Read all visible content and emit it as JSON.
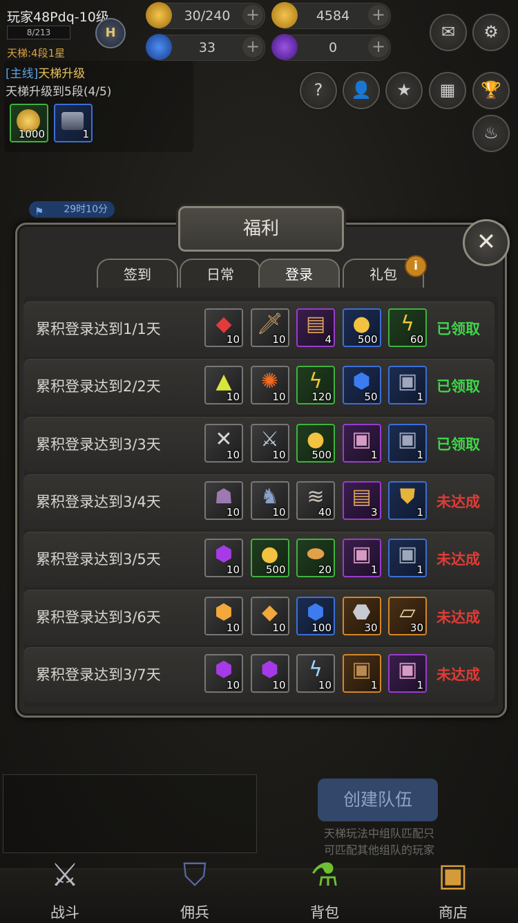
{
  "player": {
    "name": "玩家48Pdq-10级",
    "exp": "8/213",
    "ladder_rank": "天梯:4段1星",
    "badge": "H"
  },
  "resources": {
    "energy": "30/240",
    "gold": "4584",
    "gems": "33",
    "crystals": "0",
    "plus": "+"
  },
  "quest": {
    "tag": "[主线]",
    "title": "天梯升级",
    "desc": "天梯升级到5段(4/5)",
    "rewards": [
      {
        "icon": "gold-coin",
        "count": "1000"
      },
      {
        "icon": "iron-chest",
        "count": "1"
      }
    ]
  },
  "timer": "29时10分",
  "dialog": {
    "title": "福利",
    "close": "✕",
    "tabs": [
      "签到",
      "日常",
      "登录",
      "礼包"
    ],
    "active_tab": "登录",
    "info_badge": "i",
    "rows": [
      {
        "label": "累积登录达到1/1天",
        "status": "已领取",
        "items": [
          {
            "icon": "red-gem",
            "count": "10"
          },
          {
            "icon": "dagger",
            "count": "10"
          },
          {
            "icon": "scroll",
            "count": "4"
          },
          {
            "icon": "gold-coin",
            "count": "500"
          },
          {
            "icon": "energy",
            "count": "60"
          }
        ]
      },
      {
        "label": "累积登录达到2/2天",
        "status": "已领取",
        "items": [
          {
            "icon": "yellow-crystal",
            "count": "10"
          },
          {
            "icon": "fireball",
            "count": "10"
          },
          {
            "icon": "energy",
            "count": "120"
          },
          {
            "icon": "blue-gem",
            "count": "50"
          },
          {
            "icon": "iron-chest",
            "count": "1"
          }
        ]
      },
      {
        "label": "累积登录达到3/3天",
        "status": "已领取",
        "items": [
          {
            "icon": "blades",
            "count": "10"
          },
          {
            "icon": "crossed-swords",
            "count": "10"
          },
          {
            "icon": "gold-coin",
            "count": "500"
          },
          {
            "icon": "pink-chest",
            "count": "1"
          },
          {
            "icon": "iron-chest",
            "count": "1"
          }
        ]
      },
      {
        "label": "累积登录达到3/4天",
        "status": "未达成",
        "items": [
          {
            "icon": "hero-group",
            "count": "10"
          },
          {
            "icon": "knight",
            "count": "10"
          },
          {
            "icon": "cloth",
            "count": "40"
          },
          {
            "icon": "scroll",
            "count": "3"
          },
          {
            "icon": "rune-shield",
            "count": "1"
          }
        ]
      },
      {
        "label": "累积登录达到3/5天",
        "status": "未达成",
        "items": [
          {
            "icon": "purple-gem",
            "count": "10"
          },
          {
            "icon": "gold-coin",
            "count": "500"
          },
          {
            "icon": "ore",
            "count": "20"
          },
          {
            "icon": "pink-chest",
            "count": "1"
          },
          {
            "icon": "iron-chest",
            "count": "1"
          }
        ]
      },
      {
        "label": "累积登录达到3/6天",
        "status": "未达成",
        "items": [
          {
            "icon": "amber-gem",
            "count": "10"
          },
          {
            "icon": "amber-crystal",
            "count": "10"
          },
          {
            "icon": "blue-gem",
            "count": "100"
          },
          {
            "icon": "silver-gem",
            "count": "30"
          },
          {
            "icon": "book",
            "count": "30"
          }
        ]
      },
      {
        "label": "累积登录达到3/7天",
        "status": "未达成",
        "items": [
          {
            "icon": "purple-gem",
            "count": "10"
          },
          {
            "icon": "purple-gem",
            "count": "10"
          },
          {
            "icon": "lightning",
            "count": "10"
          },
          {
            "icon": "wood-chest",
            "count": "1"
          },
          {
            "icon": "pink-chest",
            "count": "1"
          }
        ]
      }
    ]
  },
  "team": {
    "create_button": "创建队伍",
    "hint_line1": "天梯玩法中组队匹配只",
    "hint_line2": "可匹配其他组队的玩家"
  },
  "nav": [
    "战斗",
    "佣兵",
    "背包",
    "商店"
  ],
  "colors": {
    "done": "#3ed64a",
    "todo": "#e23b35",
    "title_gold": "#e8c35a",
    "tag_blue": "#5da3e6"
  }
}
